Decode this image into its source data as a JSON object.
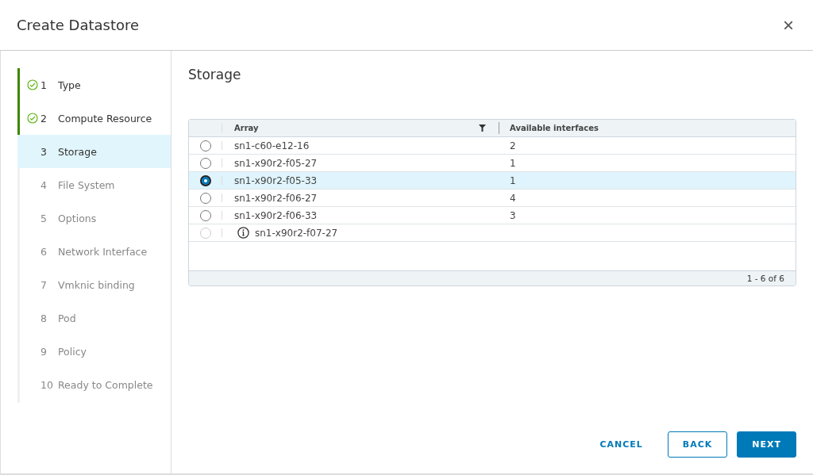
{
  "dialog": {
    "title": "Create Datastore",
    "close": "×"
  },
  "steps": [
    {
      "number": "1",
      "label": "Type",
      "completed": true,
      "selected": false
    },
    {
      "number": "2",
      "label": "Compute Resource",
      "completed": true,
      "selected": false
    },
    {
      "number": "3",
      "label": "Storage",
      "completed": false,
      "selected": true
    },
    {
      "number": "4",
      "label": "File System",
      "completed": false,
      "selected": false
    },
    {
      "number": "5",
      "label": "Options",
      "completed": false,
      "selected": false
    },
    {
      "number": "6",
      "label": "Network Interface",
      "completed": false,
      "selected": false
    },
    {
      "number": "7",
      "label": "Vmknic binding",
      "completed": false,
      "selected": false
    },
    {
      "number": "8",
      "label": "Pod",
      "completed": false,
      "selected": false
    },
    {
      "number": "9",
      "label": "Policy",
      "completed": false,
      "selected": false
    },
    {
      "number": "10",
      "label": "Ready to Complete",
      "completed": false,
      "selected": false
    }
  ],
  "section_title": "Storage",
  "table": {
    "columns": [
      "Array",
      "Available interfaces"
    ],
    "rows": [
      {
        "array": "sn1-c60-e12-16",
        "interfaces": "2",
        "selected": false,
        "disabled": false
      },
      {
        "array": "sn1-x90r2-f05-27",
        "interfaces": "1",
        "selected": false,
        "disabled": false
      },
      {
        "array": "sn1-x90r2-f05-33",
        "interfaces": "1",
        "selected": true,
        "disabled": false
      },
      {
        "array": "sn1-x90r2-f06-27",
        "interfaces": "4",
        "selected": false,
        "disabled": false
      },
      {
        "array": "sn1-x90r2-f06-33",
        "interfaces": "3",
        "selected": false,
        "disabled": false
      },
      {
        "array": "sn1-x90r2-f07-27",
        "selected": false,
        "disabled": true
      }
    ],
    "footer": "1 - 6 of 6"
  },
  "buttons": [
    {
      "label": "CANCEL",
      "kind": "flat"
    },
    {
      "label": "BACK",
      "kind": "outline"
    },
    {
      "label": "NEXT",
      "kind": "primary"
    }
  ]
}
